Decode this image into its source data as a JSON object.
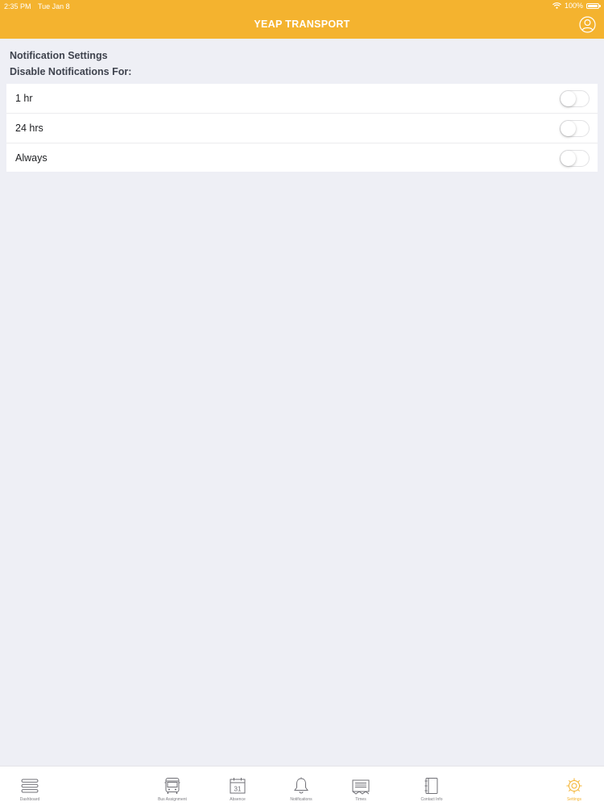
{
  "status_bar": {
    "time": "2:35 PM",
    "date": "Tue Jan 8",
    "battery": "100%"
  },
  "header": {
    "title": "YEAP TRANSPORT",
    "profile_icon": "user-circle-icon"
  },
  "settings": {
    "title": "Notification Settings",
    "subtitle": "Disable Notifications For:",
    "options": [
      {
        "label": "1 hr",
        "enabled": false
      },
      {
        "label": "24 hrs",
        "enabled": false
      },
      {
        "label": "Always",
        "enabled": false
      }
    ]
  },
  "tabs": [
    {
      "label": "Dashboard",
      "icon": "menu-lines-icon",
      "active": false
    },
    {
      "label": "Bus Assignment",
      "icon": "bus-icon",
      "active": false
    },
    {
      "label": "Absence",
      "icon": "calendar-icon",
      "active": false,
      "calendar_day": "31"
    },
    {
      "label": "Notifications",
      "icon": "bell-icon",
      "active": false
    },
    {
      "label": "Times",
      "icon": "ticket-icon",
      "active": false
    },
    {
      "label": "Contact Info",
      "icon": "notebook-icon",
      "active": false
    },
    {
      "label": "Settings",
      "icon": "gear-icon",
      "active": true
    }
  ],
  "colors": {
    "accent": "#f4b32f",
    "background": "#eeeff5",
    "inactive_icon": "#6f6f75"
  }
}
